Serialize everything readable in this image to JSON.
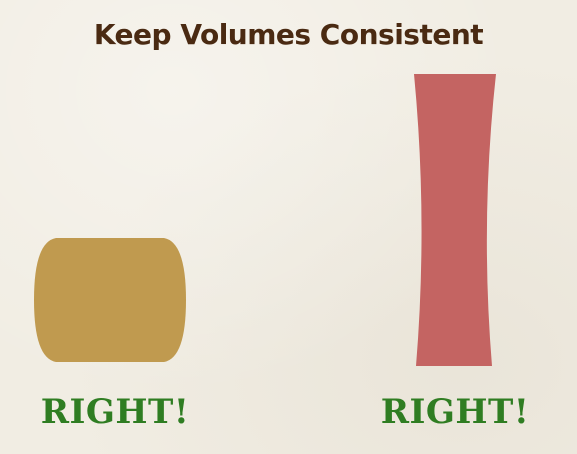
{
  "slide": {
    "title": "Keep Volumes Consistent"
  },
  "examples": [
    {
      "verdict": "RIGHT!",
      "shape_color": "#c09a4f"
    },
    {
      "verdict": "RIGHT!",
      "shape_color": "#c46462"
    }
  ],
  "colors": {
    "background": "#f1ede3",
    "title": "#4a2a12",
    "verdict": "#2f7d22"
  }
}
